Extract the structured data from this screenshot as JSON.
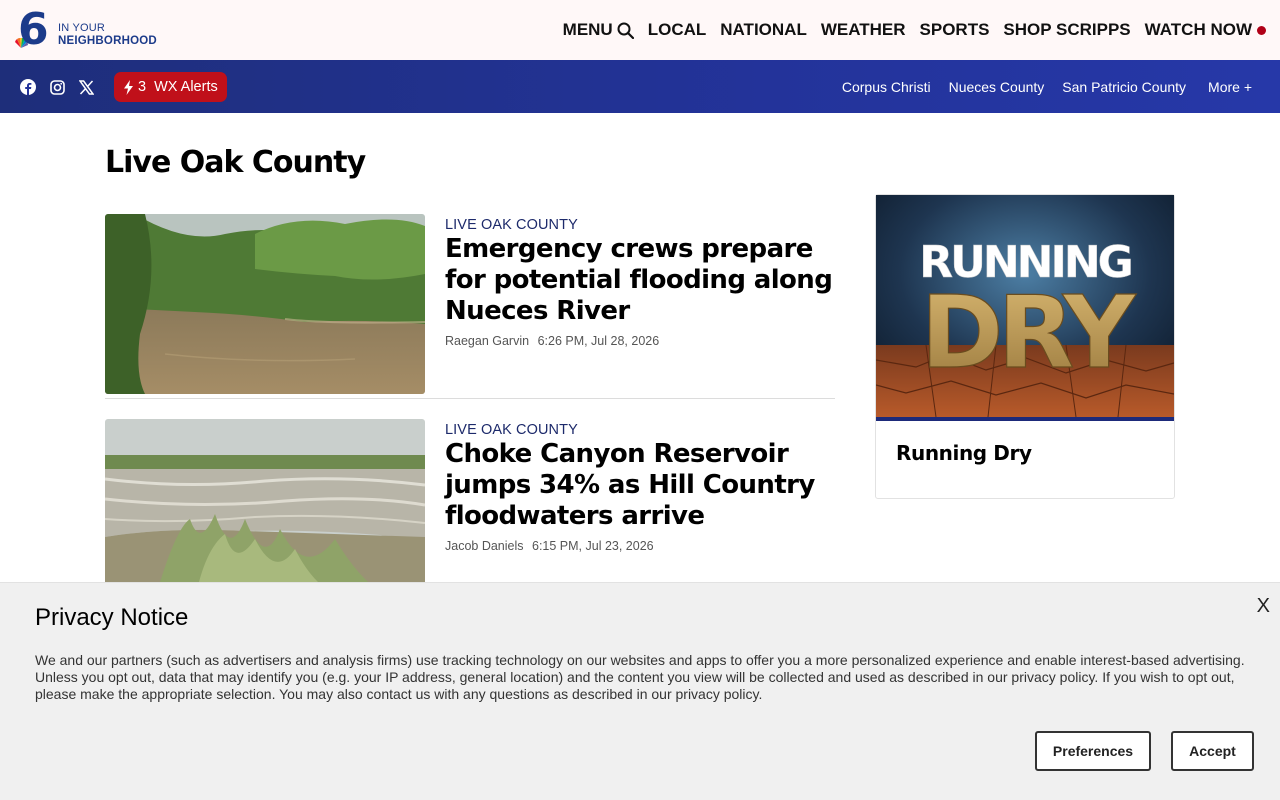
{
  "header": {
    "logo": {
      "number": "6",
      "line1": "IN YOUR",
      "line2": "NEIGHBORHOOD"
    },
    "nav": {
      "menu_label": "MENU",
      "items": [
        "LOCAL",
        "NATIONAL",
        "WEATHER",
        "SPORTS",
        "SHOP SCRIPPS"
      ],
      "watch_label": "WATCH NOW"
    }
  },
  "subheader": {
    "social": [
      "facebook-icon",
      "instagram-icon",
      "x-icon"
    ],
    "alerts": {
      "count": "3",
      "label": "WX Alerts"
    },
    "local_links": [
      "Corpus Christi",
      "Nueces County",
      "San Patricio County",
      "More +"
    ]
  },
  "page": {
    "title": "Live Oak County"
  },
  "articles": [
    {
      "kicker": "LIVE OAK COUNTY",
      "headline": "Emergency crews prepare for potential flooding along Nueces River",
      "author": "Raegan Garvin",
      "time": "6:26 PM, Jul 28, 2026"
    },
    {
      "kicker": "LIVE OAK COUNTY",
      "headline": "Choke Canyon Reservoir jumps 34% as Hill Country floodwaters arrive",
      "author": "Jacob Daniels",
      "time": "6:15 PM, Jul 23, 2026"
    }
  ],
  "sidebar": {
    "card_title": "Running Dry",
    "image_text_top": "RUNNING",
    "image_text_bottom": "DRY"
  },
  "privacy": {
    "title": "Privacy Notice",
    "close": "X",
    "text": "We and our partners (such as advertisers and analysis firms) use tracking technology on our websites and apps to offer you a more personalized experience and enable interest-based advertising. Unless you opt out, data that may identify you (e.g. your IP address, general location) and the content you view will be collected and used as described in our privacy policy. If you wish to opt out, please make the appropriate selection. You may also contact us with any questions as described in our privacy policy.",
    "preferences_label": "Preferences",
    "accept_label": "Accept"
  },
  "colors": {
    "brand_blue": "#23339a",
    "alert_red": "#c0101a",
    "live_dot": "#b00017"
  }
}
